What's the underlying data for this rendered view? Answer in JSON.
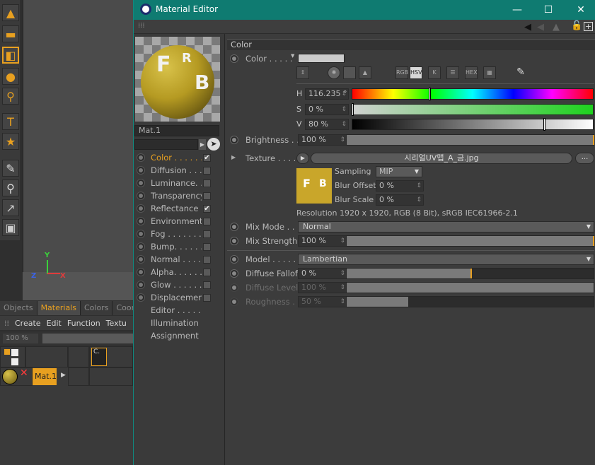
{
  "background_app": {
    "toolbar_tools": [
      "paint-tool-icon",
      "eraser-icon",
      "material-box-icon",
      "droplet-icon",
      "magnifier-icon",
      "text-tool-icon",
      "star-icon",
      "eyedropper-icon",
      "selection-icon",
      "arrow-line-icon",
      "box-icon"
    ],
    "axes": {
      "y": "Y",
      "z": "Z",
      "x": "X"
    },
    "manager_tabs": [
      "Objects",
      "Materials",
      "Colors",
      "Coor"
    ],
    "active_tab": "Materials",
    "menu": [
      "Create",
      "Edit",
      "Function",
      "Textu"
    ],
    "zoom": "100 %",
    "material_label": "Mat.1",
    "tag_label": "C."
  },
  "window": {
    "title": "Material Editor",
    "minimize": "—",
    "maximize": "☐",
    "close": "✕"
  },
  "left": {
    "preview_letters": [
      "F",
      "R",
      "B"
    ],
    "material_name": "Mat.1",
    "channels": [
      {
        "label": "Color . . . . . . .",
        "checked": true,
        "selected": true
      },
      {
        "label": "Diffusion . . . .",
        "checked": false
      },
      {
        "label": "Luminance. . . .",
        "checked": false
      },
      {
        "label": "Transparency",
        "checked": false
      },
      {
        "label": "Reflectance . .",
        "checked": true
      },
      {
        "label": "Environment",
        "checked": false
      },
      {
        "label": "Fog . . . . . . . .",
        "checked": false
      },
      {
        "label": "Bump. . . . . . .",
        "checked": false
      },
      {
        "label": "Normal . . . . . .",
        "checked": false
      },
      {
        "label": "Alpha. . . . . . .",
        "checked": false
      },
      {
        "label": "Glow . . . . . . .",
        "checked": false
      },
      {
        "label": "Displacement",
        "checked": false
      }
    ],
    "extra_items": [
      "Editor . . . . . .",
      "Illumination",
      "Assignment"
    ]
  },
  "color": {
    "section": "Color",
    "color_label": "Color . . . . .",
    "swatch": "#cccccc",
    "tools": [
      "spectrum",
      "color-wheel",
      "square",
      "image",
      "RGB",
      "HSV",
      "K",
      "mixer",
      "HEX",
      "swatches",
      "eyedropper"
    ],
    "h_label": "H",
    "h_value": "116.235 °",
    "s_label": "S",
    "s_value": "0 %",
    "v_label": "V",
    "v_value": "80 %",
    "brightness_label": "Brightness . . .",
    "brightness_value": "100 %",
    "texture_label": "Texture . . . . .",
    "texture_file": "시리얼UV맵_A_금.jpg",
    "texture_more": "...",
    "sampling_label": "Sampling",
    "sampling_value": "MIP",
    "blur_offset_label": "Blur Offset",
    "blur_offset_value": "0 %",
    "blur_scale_label": "Blur Scale",
    "blur_scale_value": "0 %",
    "resolution": "Resolution 1920 x 1920, RGB (8 Bit), sRGB IEC61966-2.1",
    "mix_mode_label": "Mix Mode . . .",
    "mix_mode_value": "Normal",
    "mix_strength_label": "Mix Strength",
    "mix_strength_value": "100 %",
    "model_label": "Model . . . . . .",
    "model_value": "Lambertian",
    "diffuse_falloff_label": "Diffuse Falloff",
    "diffuse_falloff_value": "0 %",
    "diffuse_level_label": "Diffuse Level",
    "diffuse_level_value": "100 %",
    "roughness_label": "Roughness . .",
    "roughness_value": "50 %"
  },
  "colors": {
    "accent": "#e8a020",
    "titlebar": "#0f7b71"
  }
}
